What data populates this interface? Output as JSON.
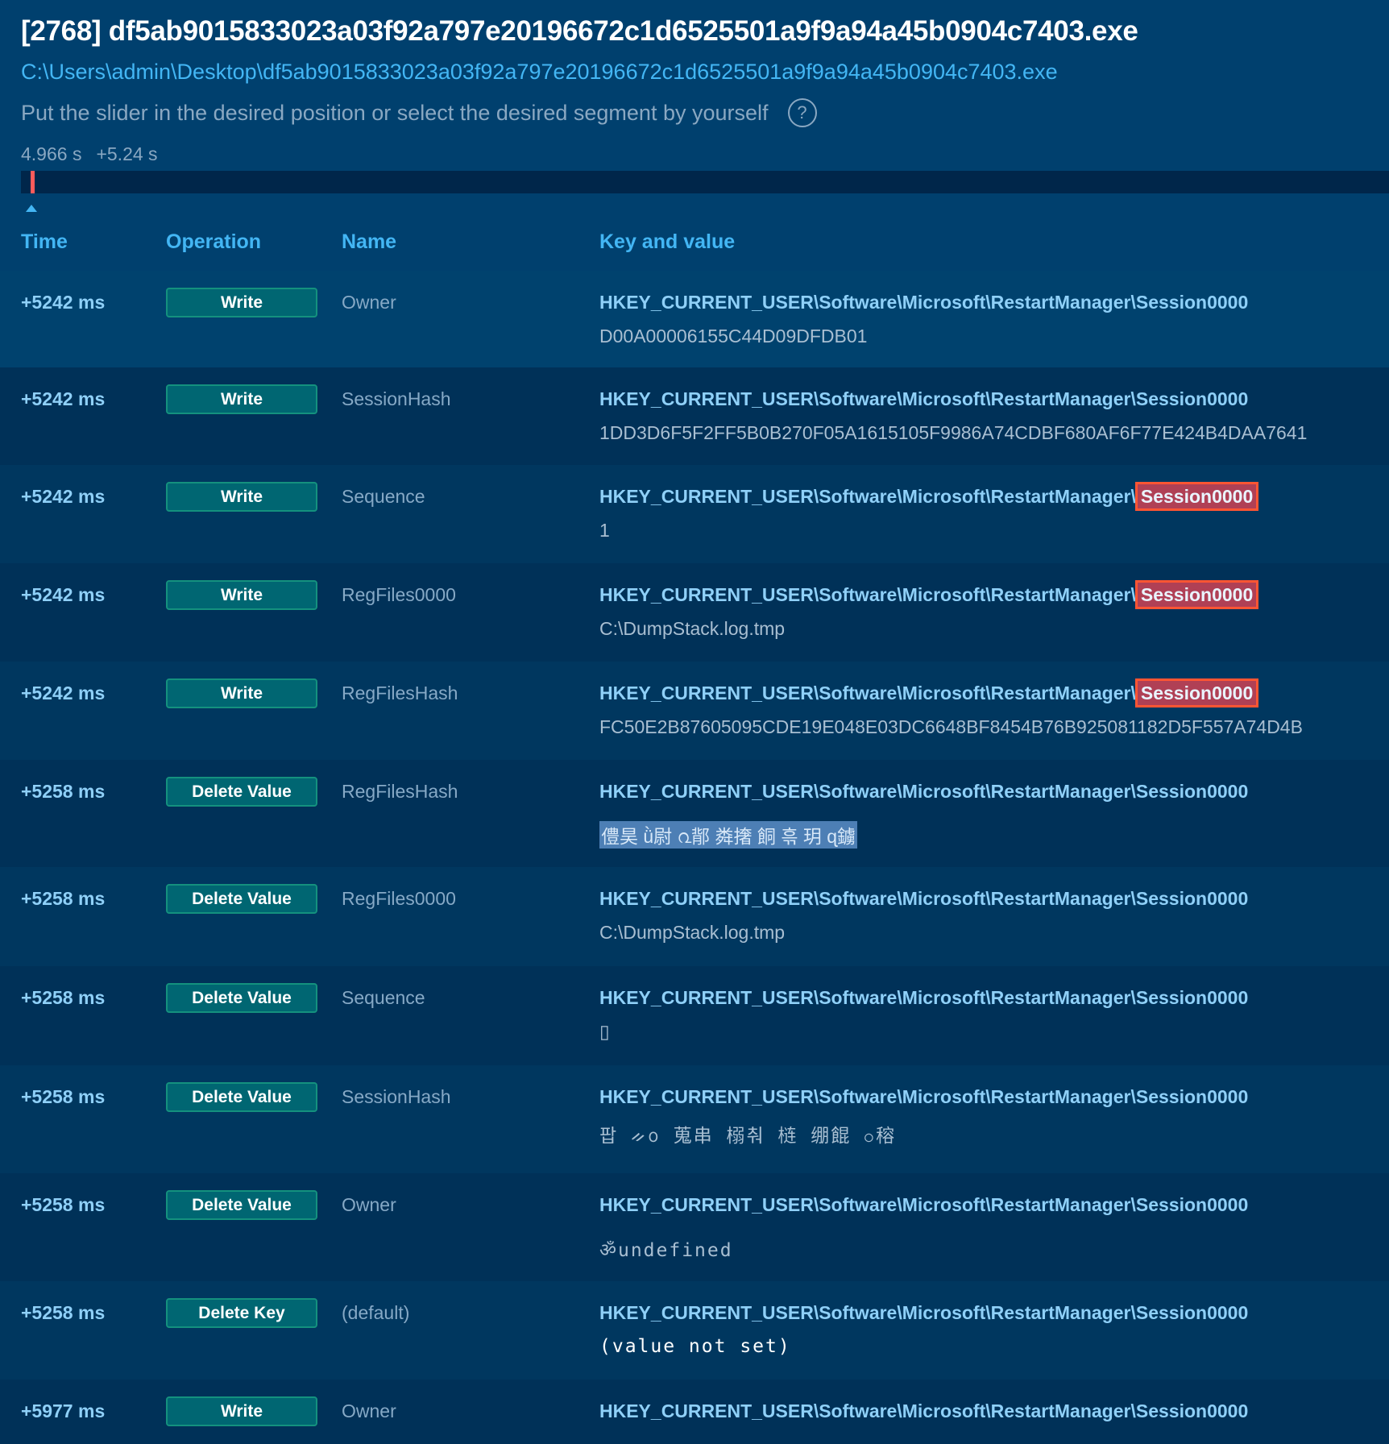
{
  "header": {
    "title": "[2768] df5ab9015833023a03f92a797e20196672c1d6525501a9f9a94a45b0904c7403.exe",
    "path": "C:\\Users\\admin\\Desktop\\df5ab9015833023a03f92a797e20196672c1d6525501a9f9a94a45b0904c7403.exe",
    "hint": "Put the slider in the desired position or select the desired segment by yourself",
    "help_icon": "?",
    "time_start": "4.966 s",
    "time_offset": "+5.24 s"
  },
  "columns": {
    "time": "Time",
    "operation": "Operation",
    "name": "Name",
    "key": "Key and value"
  },
  "key_prefix": "HKEY_CURRENT_USER\\Software\\Microsoft\\RestartManager\\",
  "key_leaf": "Session0000",
  "rows": [
    {
      "time": "+5242 ms",
      "op": "Write",
      "name": "Owner",
      "value": "D00A00006155C44D09DFDB01"
    },
    {
      "time": "+5242 ms",
      "op": "Write",
      "name": "SessionHash",
      "value": "1DD3D6F5F2FF5B0B270F05A1615105F9986A74CDBF680AF6F77E424B4DAA7641"
    },
    {
      "time": "+5242 ms",
      "op": "Write",
      "name": "Sequence",
      "value": "1"
    },
    {
      "time": "+5242 ms",
      "op": "Write",
      "name": "RegFiles0000",
      "value": "C:\\DumpStack.log.tmp"
    },
    {
      "time": "+5242 ms",
      "op": "Write",
      "name": "RegFilesHash",
      "value": "FC50E2B87605095CDE19E048E03DC6648BF8454B76B925081182D5F557A74D4B"
    },
    {
      "time": "+5258 ms",
      "op": "Delete Value",
      "name": "RegFilesHash",
      "value": "僼昊 ǜ尉 ൨鄁 粦撦  餇 흒 玥  ɋ鐪"
    },
    {
      "time": "+5258 ms",
      "op": "Delete Value",
      "name": "RegFiles0000",
      "value": "C:\\DumpStack.log.tmp"
    },
    {
      "time": "+5258 ms",
      "op": "Delete Value",
      "name": "Sequence",
      "value": "▯"
    },
    {
      "time": "+5258 ms",
      "op": "Delete Value",
      "name": "SessionHash",
      "value": "팝     ᨀ᪀ 蒐串 榒춰 梿  绷餛 ဝ穃"
    },
    {
      "time": "+5258 ms",
      "op": "Delete Value",
      "name": "Owner",
      "value": "ॐundefined"
    },
    {
      "time": "+5258 ms",
      "op": "Delete Key",
      "name": "(default)",
      "value": "(value not set)"
    },
    {
      "time": "+5977 ms",
      "op": "Write",
      "name": "Owner",
      "value": ""
    }
  ]
}
